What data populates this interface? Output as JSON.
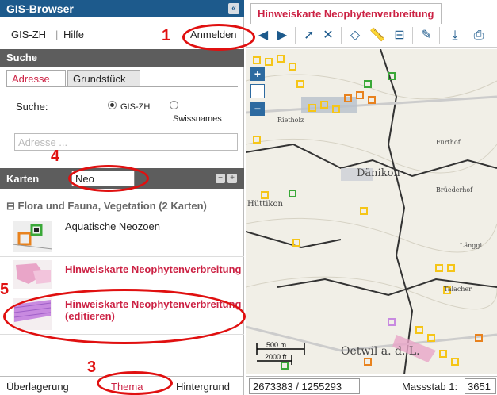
{
  "app": {
    "title": "GIS-Browser",
    "collapse_icon": "chevron-double-left-icon"
  },
  "menu": {
    "item1": "GIS-ZH",
    "item2": "Hilfe",
    "separator": "|",
    "login": "Anmelden"
  },
  "search": {
    "heading": "Suche",
    "tabs": [
      "Adresse",
      "Grundstück"
    ],
    "active_tab": "Adresse",
    "label": "Suche:",
    "options": [
      {
        "label": "GIS-ZH",
        "selected": true
      },
      {
        "label": "Swissnames",
        "selected": false
      }
    ],
    "placeholder": "Adresse ..."
  },
  "karten": {
    "heading": "Karten",
    "filter_value": "Neo",
    "minus_label": "−",
    "plus_label": "+",
    "group_label": "⊟ Flora und Fauna, Vegetation (2 Karten)",
    "items": [
      {
        "label": "Aquatische Neozoen",
        "style": "normal"
      },
      {
        "label": "Hinweiskarte Neophytenverbreitung",
        "style": "link"
      },
      {
        "label": "Hinweiskarte Neophytenverbreitung\n(editieren)",
        "style": "link"
      }
    ]
  },
  "bottom_tabs": [
    "Überlagerung",
    "Thema",
    "Hintergrund"
  ],
  "annotations": [
    "1",
    "4",
    "5",
    "3"
  ],
  "map": {
    "tab_title": "Hinweiskarte Neophytenverbreitung",
    "zoom_in": "+",
    "zoom_out": "−",
    "place_labels": [
      "Dänikon",
      "Oetwil a. d. L.",
      "Rietholz",
      "Furthof",
      "Brüederhof",
      "Talacher",
      "Länggi",
      "Hüttikon"
    ],
    "scale_bar": {
      "metric": "500 m",
      "imperial": "2000 ft"
    },
    "coordinates": "2673383 / 1255293",
    "massstab_label": "Massstab 1:",
    "scale_value": "3651"
  },
  "colors": {
    "header_blue": "#1d5a8c",
    "accent_red": "#cc2244",
    "annotation_red": "#e01010",
    "marker_yellow": "#f5c518",
    "marker_orange": "#e8821e",
    "marker_green": "#3aa838"
  }
}
